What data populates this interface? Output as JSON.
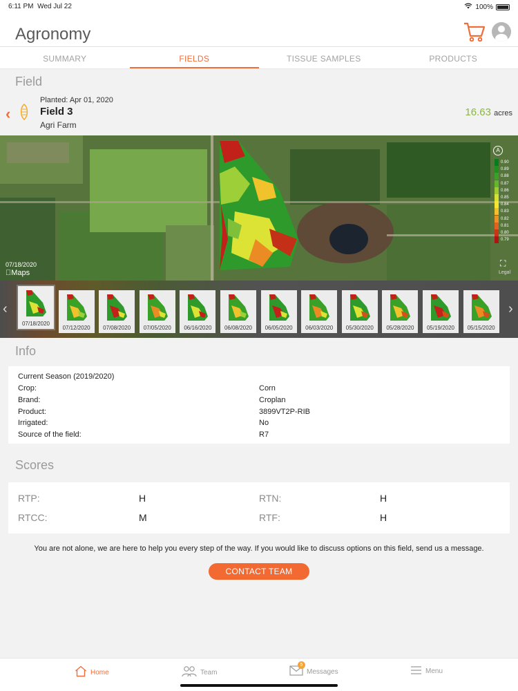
{
  "status": {
    "time": "6:11 PM",
    "date": "Wed Jul 22",
    "battery": "100%"
  },
  "header": {
    "title": "Agronomy"
  },
  "tabs": [
    {
      "label": "SUMMARY"
    },
    {
      "label": "FIELDS"
    },
    {
      "label": "TISSUE SAMPLES"
    },
    {
      "label": "PRODUCTS"
    }
  ],
  "field_section": {
    "label": "Field"
  },
  "field": {
    "planted": "Planted:  Apr 01, 2020",
    "name": "Field 3",
    "farm": "Agri Farm",
    "acres_value": "16.63",
    "acres_unit": "acres"
  },
  "map": {
    "date": "07/18/2020",
    "brand": "Maps",
    "legal": "Legal",
    "legend": [
      {
        "value": "0.90",
        "color": "#0a7a1e"
      },
      {
        "value": "0.89",
        "color": "#1f8f22"
      },
      {
        "value": "0.88",
        "color": "#3aa128"
      },
      {
        "value": "0.87",
        "color": "#67b52d"
      },
      {
        "value": "0.86",
        "color": "#9fcb31"
      },
      {
        "value": "0.85",
        "color": "#d8e034"
      },
      {
        "value": "0.84",
        "color": "#f5e632"
      },
      {
        "value": "0.83",
        "color": "#f3c02b"
      },
      {
        "value": "0.82",
        "color": "#ec9124"
      },
      {
        "value": "0.81",
        "color": "#e0621c"
      },
      {
        "value": "0.80",
        "color": "#cb3516"
      },
      {
        "value": "0.79",
        "color": "#b01412"
      }
    ]
  },
  "thumbnails": [
    {
      "date": "07/18/2020",
      "active": true
    },
    {
      "date": "07/12/2020"
    },
    {
      "date": "07/08/2020"
    },
    {
      "date": "07/05/2020"
    },
    {
      "date": "06/16/2020"
    },
    {
      "date": "06/08/2020"
    },
    {
      "date": "06/05/2020"
    },
    {
      "date": "06/03/2020"
    },
    {
      "date": "05/30/2020"
    },
    {
      "date": "05/28/2020"
    },
    {
      "date": "05/19/2020"
    },
    {
      "date": "05/15/2020"
    }
  ],
  "info_section": {
    "label": "Info"
  },
  "info": {
    "season": "Current Season (2019/2020)",
    "rows": [
      {
        "label": "Crop:",
        "value": "Corn"
      },
      {
        "label": "Brand:",
        "value": "Croplan"
      },
      {
        "label": "Product:",
        "value": "3899VT2P-RIB"
      },
      {
        "label": "Irrigated:",
        "value": "No"
      },
      {
        "label": "Source of the field:",
        "value": "R7"
      }
    ]
  },
  "scores_section": {
    "label": "Scores"
  },
  "scores": [
    {
      "label": "RTP:",
      "value": "H"
    },
    {
      "label": "RTN:",
      "value": "H"
    },
    {
      "label": "RTCC:",
      "value": "M"
    },
    {
      "label": "RTF:",
      "value": "H"
    }
  ],
  "help_text": "You are not alone, we are here to help you every step of the way. If you would like to discuss options on this field, send us a message.",
  "contact_button": "CONTACT TEAM",
  "bottom_nav": {
    "home": "Home",
    "team": "Team",
    "messages": "Messages",
    "messages_badge": "5",
    "menu": "Menu"
  },
  "colors": {
    "accent": "#ef6e3a",
    "acres": "#8ab63f"
  }
}
